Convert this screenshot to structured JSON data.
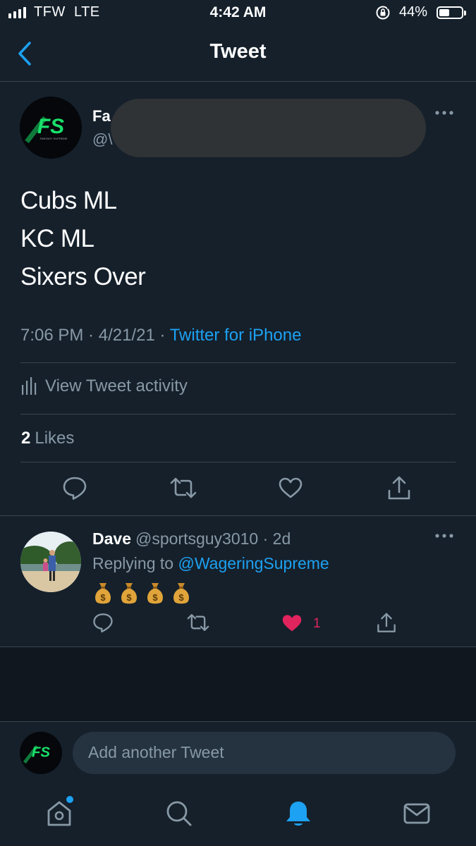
{
  "status_bar": {
    "carrier": "TFW",
    "network": "LTE",
    "time": "4:42 AM",
    "battery_percent": "44%",
    "battery_level": 0.44,
    "signal_bars": 4
  },
  "header": {
    "title": "Tweet",
    "back_icon": "chevron-left-icon"
  },
  "tweet": {
    "author_name_visible": "Fa",
    "author_handle_visible": "@\\",
    "avatar_text": "FS",
    "avatar_subtext": "FANTASY SUPREME",
    "lines": [
      "Cubs ML",
      "KC ML",
      "Sixers Over"
    ],
    "time": "7:06 PM",
    "date": "4/21/21",
    "source": "Twitter for iPhone",
    "activity_label": "View Tweet activity",
    "likes_count": "2",
    "likes_label": "Likes",
    "actions": [
      "reply-icon",
      "retweet-icon",
      "like-icon",
      "share-icon"
    ]
  },
  "reply": {
    "name": "Dave",
    "handle": "@sportsguy3010",
    "age": "2d",
    "replying_prefix": "Replying to",
    "replying_to": "@WageringSupreme",
    "emoji": [
      "money-bag-icon",
      "money-bag-icon",
      "money-bag-icon",
      "money-bag-icon"
    ],
    "like_count": "1",
    "liked": true
  },
  "compose": {
    "placeholder": "Add another Tweet"
  },
  "tab_bar": {
    "items": [
      "home-icon",
      "search-icon",
      "notifications-icon",
      "messages-icon"
    ],
    "active": "notifications-icon",
    "home_badge": true
  },
  "colors": {
    "background": "#15202b",
    "accent": "#1da1f2",
    "muted": "#8899a6",
    "divider": "#38444d",
    "like": "#e0245e",
    "logo_green": "#19e06b"
  }
}
